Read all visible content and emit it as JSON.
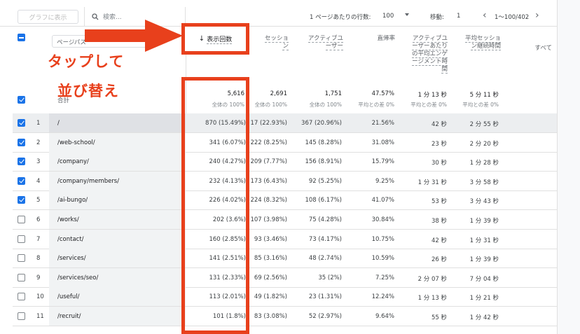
{
  "toolbar": {
    "chart_button": "グラフに表示",
    "search_placeholder": "検索...",
    "rows_per_page_label": "1 ページあたりの行数:",
    "rows_per_page_value": "100",
    "goto_label": "移動:",
    "goto_value": "1",
    "range_text": "1〜100/402"
  },
  "header": {
    "dimension": "ページパス",
    "sort_col": "表示回数",
    "columns": [
      "セッション",
      "アクティブユーザー",
      "直帰率",
      "アクティブユーザーあたりの平均エンゲージメント時間",
      "平均セッション継続時間",
      "すべて"
    ]
  },
  "annotation": {
    "line1": "タップして",
    "line2": "並び替え"
  },
  "totals": {
    "label": "合計",
    "values": [
      "5,616",
      "2,691",
      "1,751",
      "47.57%",
      "1 分 13 秒",
      "5 分 11 秒"
    ],
    "subs": [
      "全体の 100%",
      "全体の 100%",
      "全体の 100%",
      "平均との差 0%",
      "平均との差 0%",
      "平均との差 0%"
    ]
  },
  "rows": [
    {
      "n": "1",
      "path": "/",
      "views": "870 (15.49%)",
      "sessions": "17 (22.93%)",
      "users": "367 (20.96%)",
      "bounce": "21.56%",
      "eng": "42 秒",
      "dur": "2 分 55 秒",
      "checked": true
    },
    {
      "n": "2",
      "path": "/web-school/",
      "views": "341 (6.07%)",
      "sessions": "222 (8.25%)",
      "users": "145 (8.28%)",
      "bounce": "31.08%",
      "eng": "23 秒",
      "dur": "2 分 20 秒",
      "checked": true
    },
    {
      "n": "3",
      "path": "/company/",
      "views": "240 (4.27%)",
      "sessions": "209 (7.77%)",
      "users": "156 (8.91%)",
      "bounce": "15.79%",
      "eng": "30 秒",
      "dur": "1 分 28 秒",
      "checked": true
    },
    {
      "n": "4",
      "path": "/company/members/",
      "views": "232 (4.13%)",
      "sessions": "173 (6.43%)",
      "users": "92 (5.25%)",
      "bounce": "9.25%",
      "eng": "1 分 31 秒",
      "dur": "3 分 58 秒",
      "checked": true
    },
    {
      "n": "5",
      "path": "/ai-bungo/",
      "views": "226 (4.02%)",
      "sessions": "224 (8.32%)",
      "users": "108 (6.17%)",
      "bounce": "41.07%",
      "eng": "53 秒",
      "dur": "3 分 43 秒",
      "checked": true
    },
    {
      "n": "6",
      "path": "/works/",
      "views": "202 (3.6%)",
      "sessions": "107 (3.98%)",
      "users": "75 (4.28%)",
      "bounce": "30.84%",
      "eng": "38 秒",
      "dur": "1 分 39 秒",
      "checked": false
    },
    {
      "n": "7",
      "path": "/contact/",
      "views": "160 (2.85%)",
      "sessions": "93 (3.46%)",
      "users": "73 (4.17%)",
      "bounce": "10.75%",
      "eng": "42 秒",
      "dur": "1 分 31 秒",
      "checked": false
    },
    {
      "n": "8",
      "path": "/services/",
      "views": "141 (2.51%)",
      "sessions": "85 (3.16%)",
      "users": "48 (2.74%)",
      "bounce": "10.59%",
      "eng": "26 秒",
      "dur": "1 分 39 秒",
      "checked": false
    },
    {
      "n": "9",
      "path": "/services/seo/",
      "views": "131 (2.33%)",
      "sessions": "69 (2.56%)",
      "users": "35 (2%)",
      "bounce": "7.25%",
      "eng": "2 分 07 秒",
      "dur": "7 分 04 秒",
      "checked": false
    },
    {
      "n": "10",
      "path": "/useful/",
      "views": "113 (2.01%)",
      "sessions": "49 (1.82%)",
      "users": "23 (1.31%)",
      "bounce": "12.24%",
      "eng": "1 分 13 秒",
      "dur": "1 分 21 秒",
      "checked": false
    },
    {
      "n": "11",
      "path": "/recruit/",
      "views": "101 (1.8%)",
      "sessions": "83 (3.08%)",
      "users": "52 (2.97%)",
      "bounce": "9.64%",
      "eng": "55 秒",
      "dur": "1 分 42 秒",
      "checked": false
    }
  ],
  "colors": {
    "accent": "#1a73e8",
    "annotation": "#e8401c"
  }
}
